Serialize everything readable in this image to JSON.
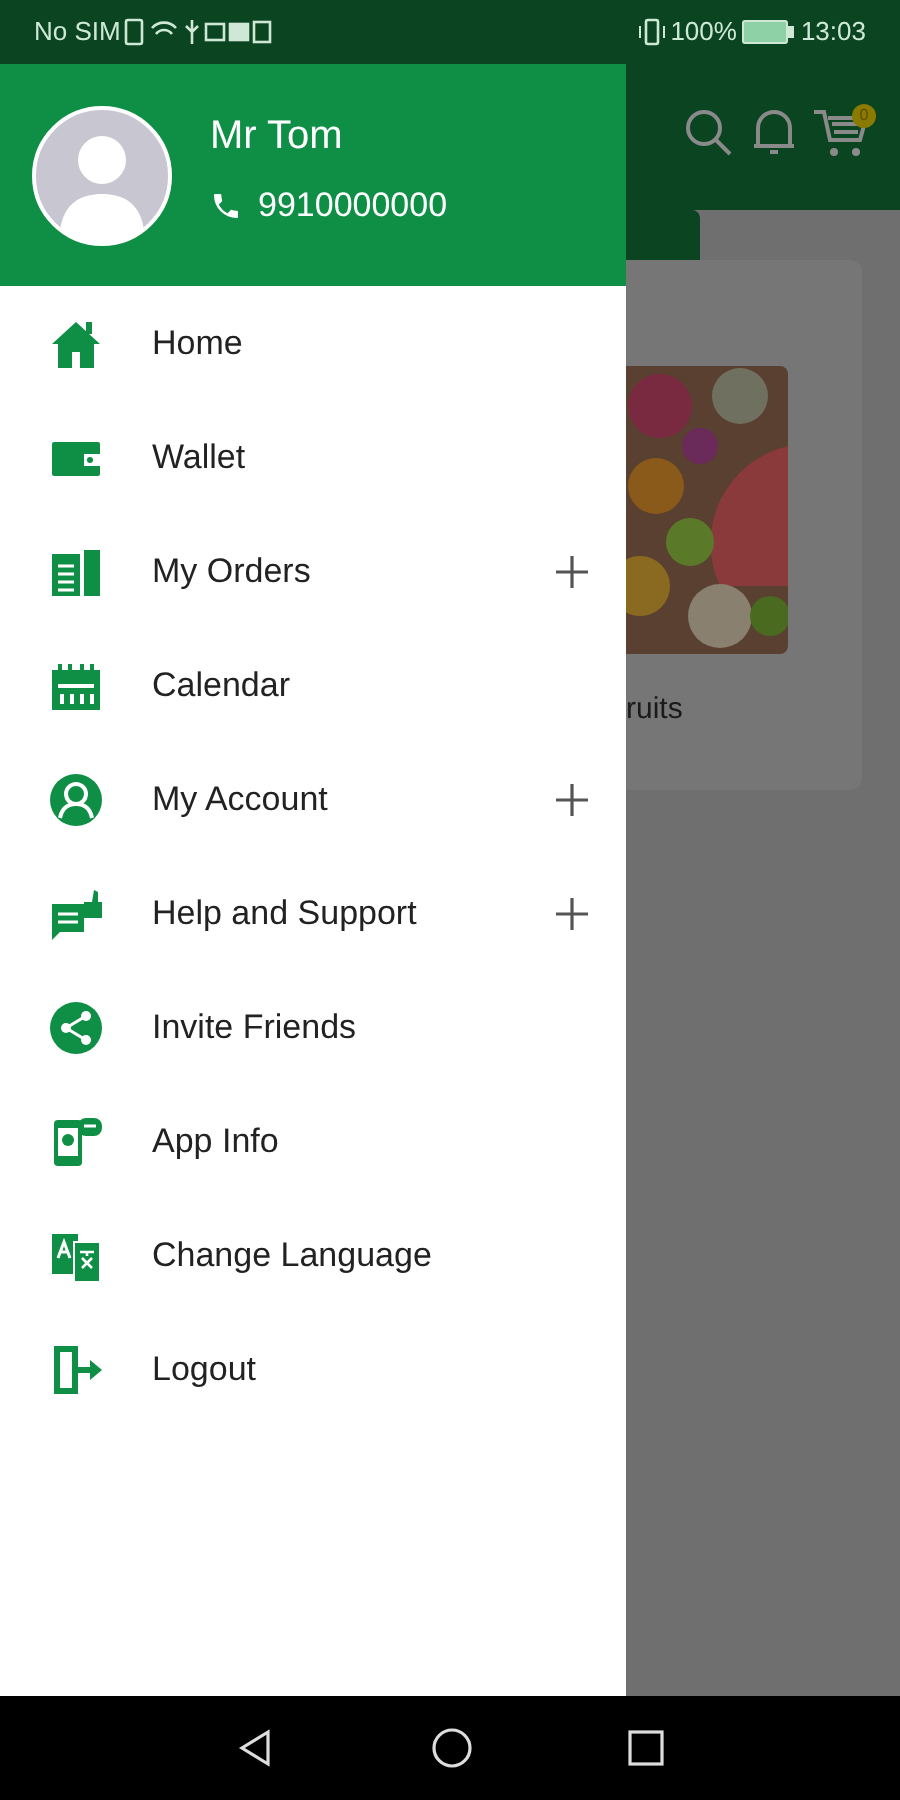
{
  "status_bar": {
    "carrier": "No SIM",
    "battery": "100%",
    "time": "13:03"
  },
  "background_page": {
    "cart_count": "0",
    "card_label": "ruits"
  },
  "drawer": {
    "user_name": "Mr Tom",
    "phone": "9910000000",
    "items": [
      {
        "label": "Home",
        "expandable": false
      },
      {
        "label": "Wallet",
        "expandable": false
      },
      {
        "label": "My Orders",
        "expandable": true
      },
      {
        "label": "Calendar",
        "expandable": false
      },
      {
        "label": "My Account",
        "expandable": true
      },
      {
        "label": "Help and Support",
        "expandable": true
      },
      {
        "label": "Invite Friends",
        "expandable": false
      },
      {
        "label": "App Info",
        "expandable": false
      },
      {
        "label": "Change Language",
        "expandable": false
      },
      {
        "label": "Logout",
        "expandable": false
      }
    ]
  }
}
